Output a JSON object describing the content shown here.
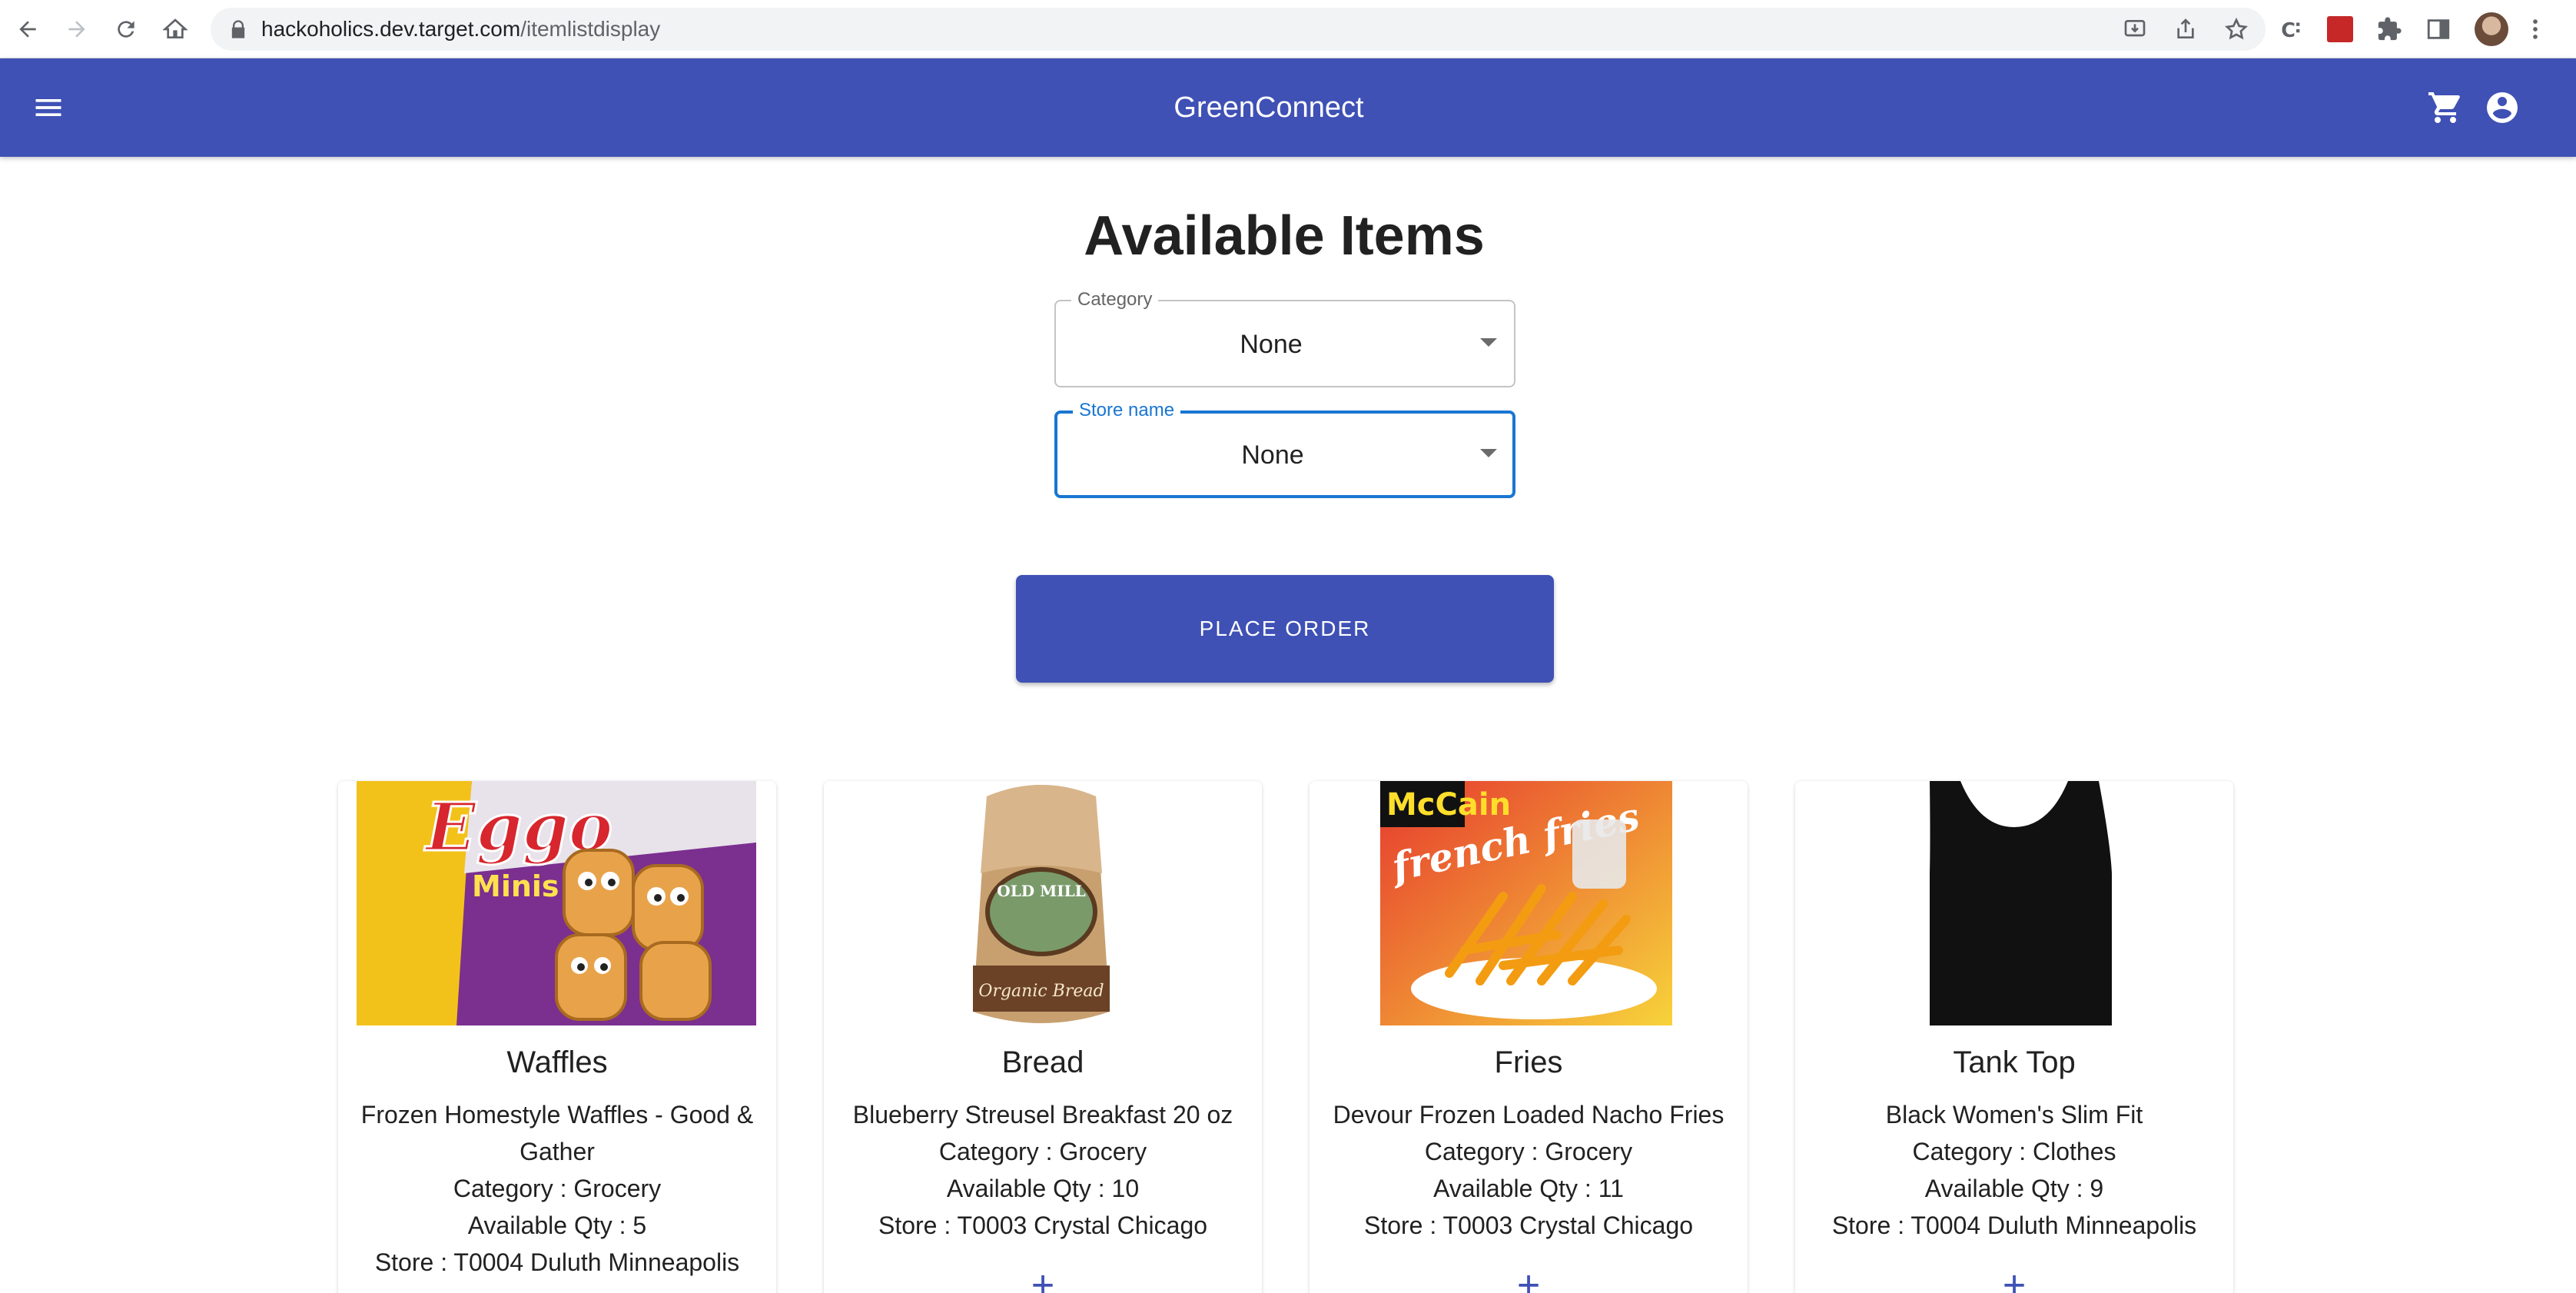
{
  "browser": {
    "url_host": "hackoholics.dev.target.com",
    "url_path": "/itemlistdisplay"
  },
  "app": {
    "title": "GreenConnect"
  },
  "page": {
    "title": "Available Items"
  },
  "filters": {
    "category": {
      "label": "Category",
      "value": "None"
    },
    "store": {
      "label": "Store name",
      "value": "None"
    }
  },
  "actions": {
    "place_order": "PLACE ORDER"
  },
  "items": [
    {
      "name": "Waffles",
      "description": "Frozen Homestyle Waffles - Good & Gather",
      "category": "Category : Grocery",
      "qty": "Available Qty : 5",
      "store": "Store : T0004 Duluth Minneapolis",
      "add_label": "+"
    },
    {
      "name": "Bread",
      "description": "Blueberry Streusel Breakfast 20 oz",
      "category": "Category : Grocery",
      "qty": "Available Qty : 10",
      "store": "Store : T0003 Crystal Chicago",
      "add_label": "+"
    },
    {
      "name": "Fries",
      "description": "Devour Frozen Loaded Nacho Fries",
      "category": "Category : Grocery",
      "qty": "Available Qty : 11",
      "store": "Store : T0003 Crystal Chicago",
      "add_label": "+"
    },
    {
      "name": "Tank Top",
      "description": "Black Women's Slim Fit",
      "category": "Category : Clothes",
      "qty": "Available Qty : 9",
      "store": "Store : T0004 Duluth Minneapolis",
      "add_label": "+"
    }
  ],
  "image_text": {
    "waffles_brand": "Eggo",
    "waffles_sub": "Minis",
    "bread_brand": "OLD MILL",
    "bread_sub": "Organic Bread",
    "fries_brand": "McCain",
    "fries_sub": "french fries"
  },
  "colors": {
    "primary": "#3f51b5",
    "focus": "#1976d2"
  }
}
